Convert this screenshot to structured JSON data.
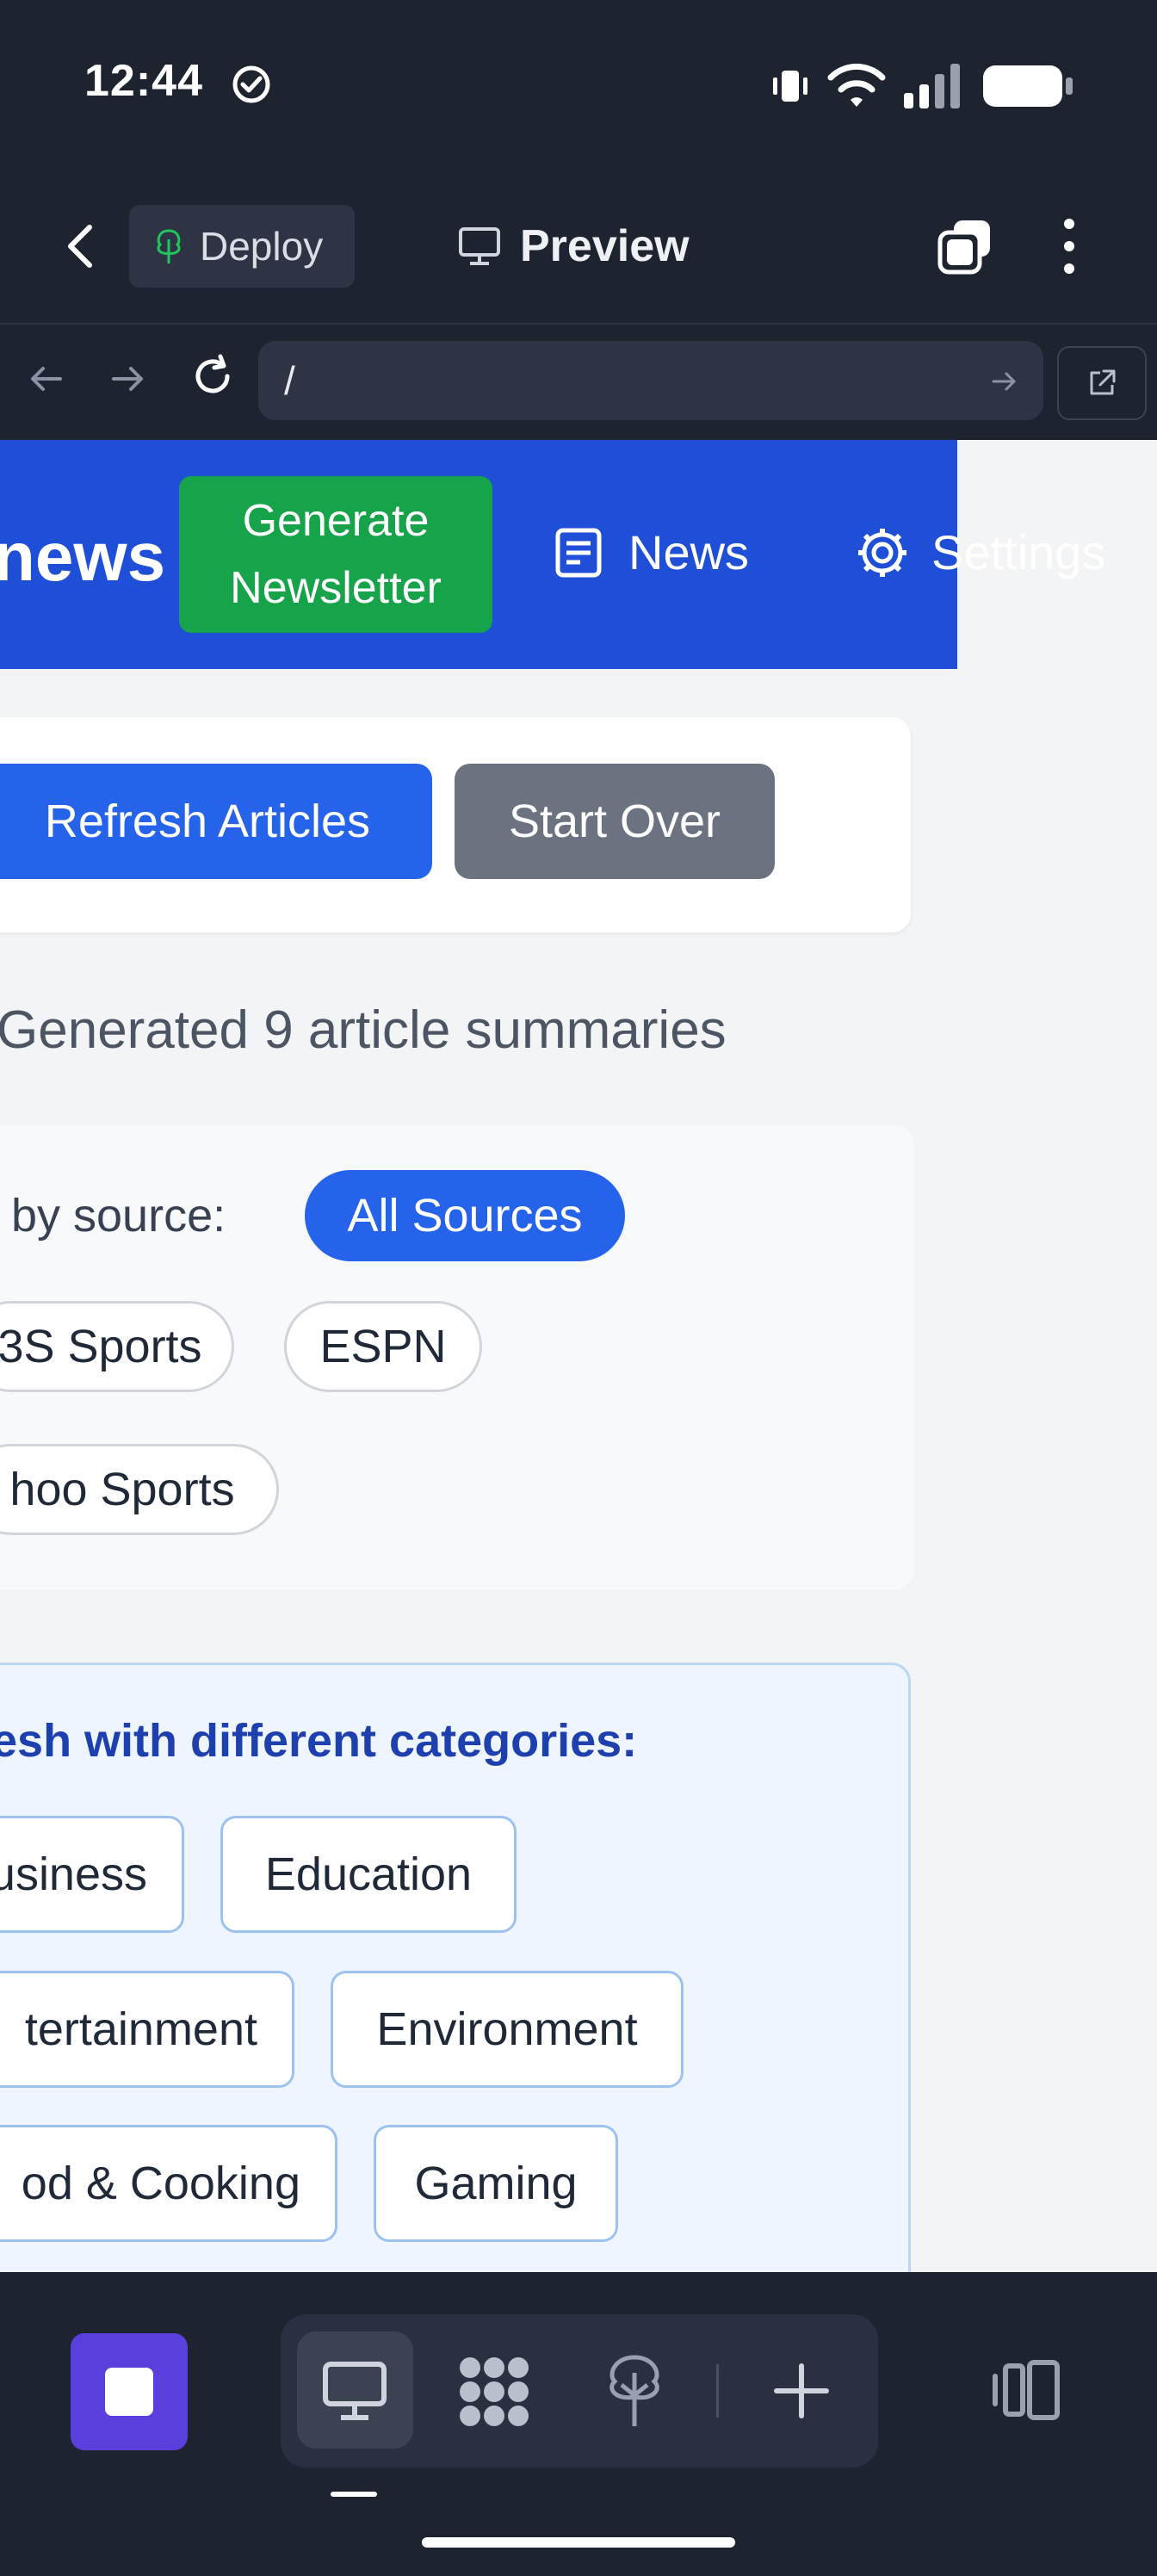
{
  "status_bar": {
    "time": "12:44"
  },
  "app_bar": {
    "deploy_label": "Deploy",
    "preview_label": "Preview"
  },
  "browser": {
    "url": "/"
  },
  "site": {
    "brand": "news",
    "generate_button": "Generate Newsletter",
    "nav_news": "News",
    "nav_settings": "Settings",
    "refresh_button": "Refresh Articles",
    "start_over_button": "Start Over",
    "summary_text": "Generated 9 article summaries",
    "filter_label": "r by source:",
    "sources": [
      "All Sources",
      "3S Sports",
      "ESPN",
      "hoo Sports"
    ],
    "active_source": "All Sources",
    "categories_heading": "esh with different categories:",
    "categories": [
      "usiness",
      "Education",
      "tertainment",
      "Environment",
      "od & Cooking",
      "Gaming"
    ]
  },
  "colors": {
    "nav_bg": "#1f4fd6",
    "generate_bg": "#16a34a",
    "primary": "#2563eb",
    "secondary": "#6b7280",
    "app_bg": "#1e2330",
    "accent_purple": "#5b3fdc"
  }
}
